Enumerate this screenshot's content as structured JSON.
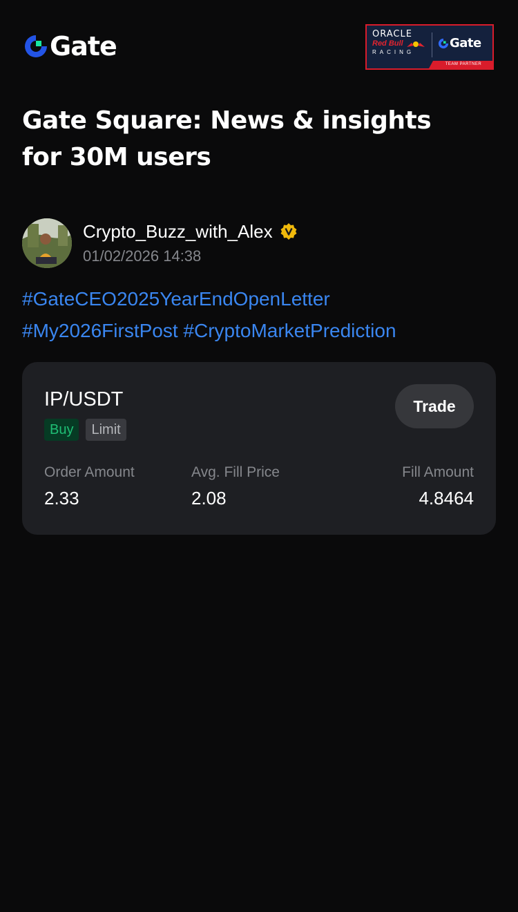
{
  "header": {
    "logo_text": "Gate",
    "partner": {
      "oracle": "ORACLE",
      "red_bull": "Red Bull",
      "racing": "RACING",
      "gate": "Gate",
      "ribbon": "TEAM PARTNER"
    }
  },
  "headline": "Gate Square: News & insights for 30M users",
  "post": {
    "author": "Crypto_Buzz_with_Alex",
    "verified_icon": "verified-badge-icon",
    "timestamp": "01/02/2026 14:38",
    "hashtags": [
      "#GateCEO2025YearEndOpenLetter",
      "#My2026FirstPost",
      "#CryptoMarketPrediction"
    ]
  },
  "trade_card": {
    "pair": "IP/USDT",
    "side": "Buy",
    "order_type": "Limit",
    "trade_button": "Trade",
    "stats": [
      {
        "label": "Order Amount",
        "value": "2.33"
      },
      {
        "label": "Avg. Fill Price",
        "value": "2.08"
      },
      {
        "label": "Fill Amount",
        "value": "4.8464"
      }
    ]
  },
  "colors": {
    "background": "#0a0a0b",
    "card": "#1e1f23",
    "hashtag": "#3a86f0",
    "buy_green": "#1fbf75",
    "brand_blue": "#2354e6",
    "brand_green": "#17e6a1",
    "verified_gold": "#f0b90b"
  }
}
